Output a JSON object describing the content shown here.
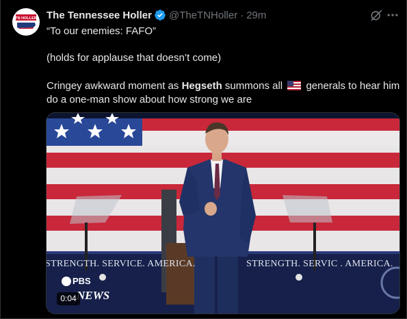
{
  "post": {
    "author_name": "The Tennessee Holler",
    "handle": "@TheTNHoller",
    "separator": "·",
    "time": "29m",
    "avatar_text": "TN HOLLER",
    "line1": "“To our enemies: FAFO”",
    "line2": "(holds for applause that doesn’t come)",
    "line3_pre": "Cringey awkward moment as ",
    "line3_bold": "Hegseth",
    "line3_mid": " summons all ",
    "line3_post": " generals to hear him",
    "line4": "do a one-man show about how strong we are"
  },
  "media": {
    "banner_left": "STRENGTH. SERVICE. AMERICA.",
    "banner_right": "STRENGTH. SERVIC . AMERICA.",
    "logo_top": "PBS",
    "logo_bottom": "NEWS",
    "video_time": "0:04"
  },
  "icons": {
    "verified": "verified-badge-icon",
    "grok": "grok-icon",
    "more": "more-options-icon",
    "flag": "us-flag-emoji"
  },
  "colors": {
    "background": "#000000",
    "text_primary": "#e7e9ea",
    "text_secondary": "#71767b",
    "verified_blue": "#1d9bf0"
  }
}
